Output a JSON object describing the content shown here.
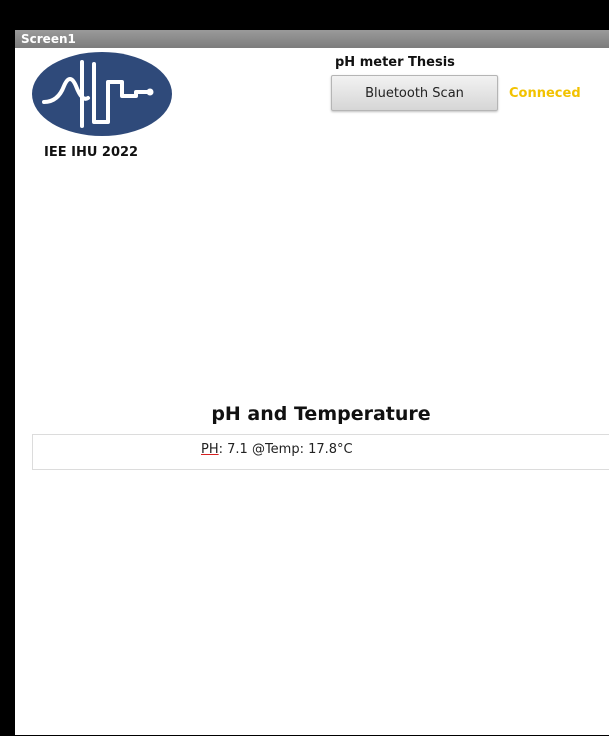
{
  "window": {
    "title": "Screen1"
  },
  "logo": {
    "icon": "waveform-circuit-logo",
    "caption": "IEE IHU 2022",
    "colors": {
      "circle": "#2f4a7a",
      "glyph": "#ffffff"
    }
  },
  "header": {
    "title": "pH meter Thesis",
    "bluetooth_button_label": "Bluetooth Scan",
    "status": "Conneced",
    "status_color": "#f2c200"
  },
  "readings": {
    "title": "pH and Temperature",
    "ph_label": "PH",
    "ph_rest": ": 7.1 @Temp: 17.8°C"
  }
}
